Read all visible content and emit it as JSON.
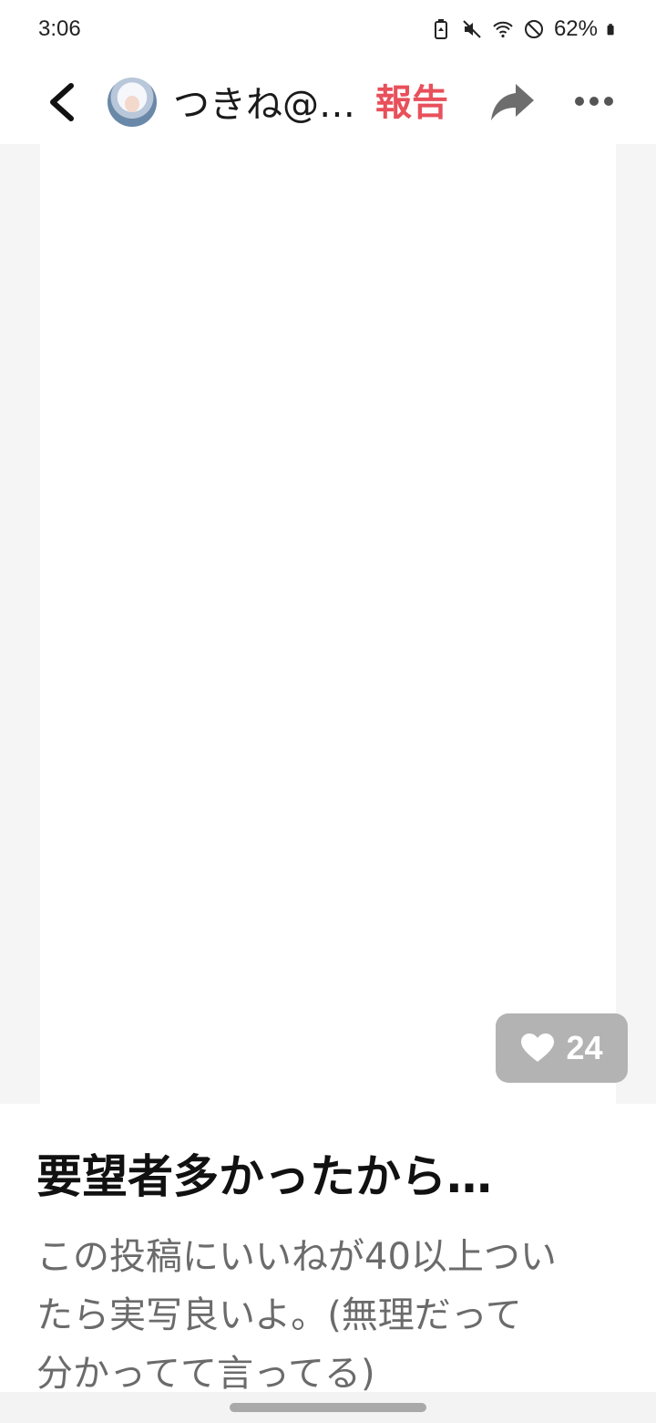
{
  "status_bar": {
    "time": "3:06",
    "battery_percent": "62%"
  },
  "header": {
    "author_name": "つきね@…",
    "report_label": "報告",
    "icons": [
      "back-chevron-icon",
      "share-icon",
      "more-dots-icon"
    ]
  },
  "post": {
    "like_count": "24",
    "title": "要望者多かったから…",
    "body_lines": [
      "この投稿にいいねが40以上つい",
      "たら実写良いよ。(無理だって",
      "分かってて言ってる)"
    ]
  },
  "colors": {
    "accent_red": "#e8505b",
    "badge_gray": "#b3b3b3",
    "body_gray": "#6b6b6b"
  }
}
